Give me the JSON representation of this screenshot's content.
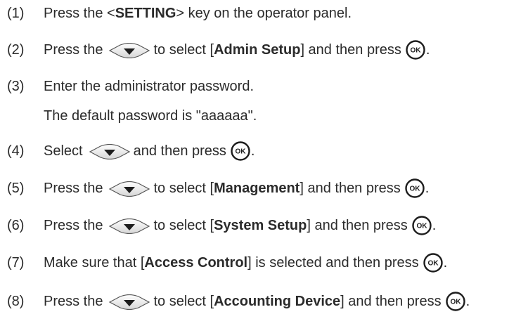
{
  "steps": [
    {
      "num": "(1)",
      "a": "Press the <",
      "b": "SETTING",
      "c": "> key on the operator panel."
    },
    {
      "num": "(2)",
      "a": "Press the",
      "b": "to select [",
      "c": "Admin Setup",
      "d": "] and then press",
      "e": "."
    },
    {
      "num": "(3)",
      "a": "Enter the administrator password."
    },
    {
      "num": "(4)",
      "a": "Select",
      "b": "and then press",
      "c": "."
    },
    {
      "num": "(5)",
      "a": "Press the",
      "b": "to select [",
      "c": "Management",
      "d": "] and then press",
      "e": "."
    },
    {
      "num": "(6)",
      "a": "Press the",
      "b": "to select [",
      "c": "System Setup",
      "d": "] and then press",
      "e": "."
    },
    {
      "num": "(7)",
      "a": "Make sure that [",
      "b": "Access Control",
      "c": "] is selected and then press",
      "d": "."
    },
    {
      "num": "(8)",
      "a": "Press the",
      "b": "to select [",
      "c": "Accounting Device",
      "d": "] and then press",
      "e": "."
    }
  ],
  "note": "The default password is \"aaaaaa\".",
  "ok_key_label": "OK",
  "icons": {
    "down": "down-arrow-key-icon",
    "ok": "ok-button-icon"
  }
}
